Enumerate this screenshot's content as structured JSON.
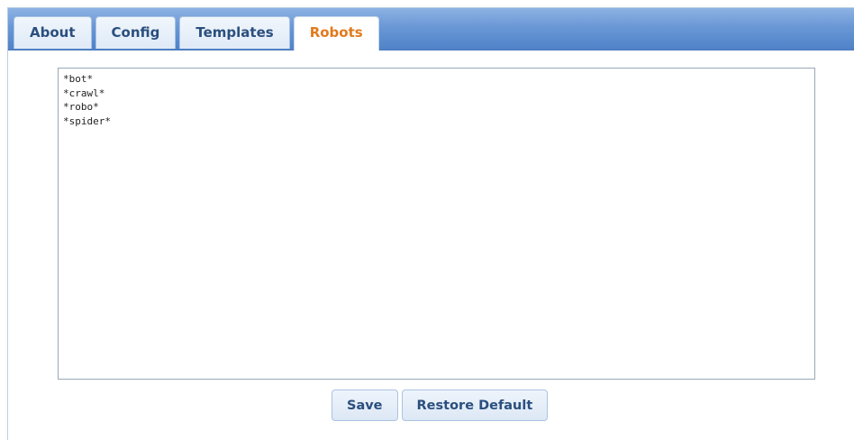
{
  "tabs": [
    {
      "label": "About",
      "active": false
    },
    {
      "label": "Config",
      "active": false
    },
    {
      "label": "Templates",
      "active": false
    },
    {
      "label": "Robots",
      "active": true
    }
  ],
  "editor": {
    "value": "*bot*\n*crawl*\n*robo*\n*spider*"
  },
  "actions": {
    "save_label": "Save",
    "restore_label": "Restore Default"
  },
  "colors": {
    "tabbar": "#6a98d6",
    "active_tab_text": "#e27a1d",
    "tab_text": "#2a4f7e"
  }
}
